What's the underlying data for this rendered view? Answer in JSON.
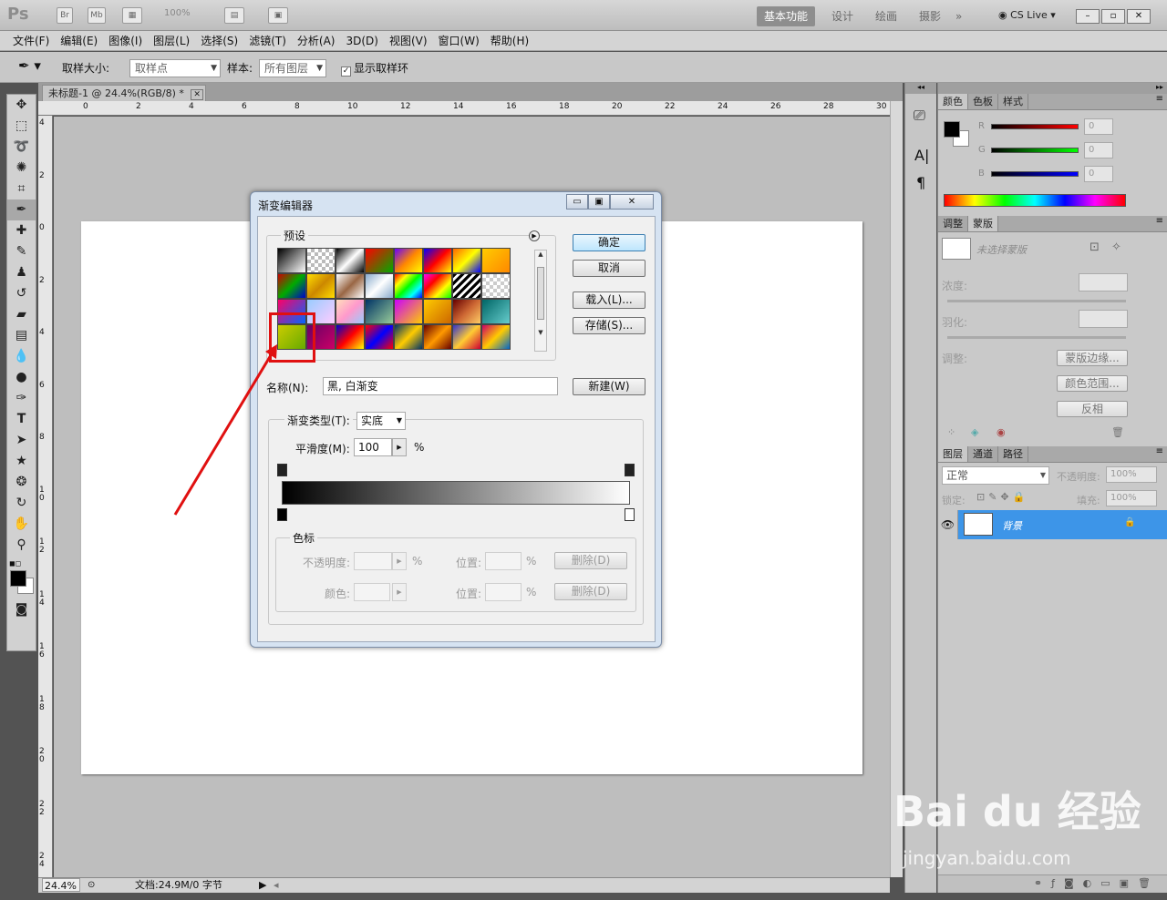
{
  "appbar": {
    "logo": "Ps",
    "icons": [
      "Br",
      "Mb"
    ],
    "zoom": "100%",
    "workspaces": [
      "基本功能",
      "设计",
      "绘画",
      "摄影"
    ],
    "more": "»",
    "cslive": "CS Live",
    "window_buttons": [
      "–",
      "▫",
      "✕"
    ]
  },
  "menu": [
    "文件(F)",
    "编辑(E)",
    "图像(I)",
    "图层(L)",
    "选择(S)",
    "滤镜(T)",
    "分析(A)",
    "3D(D)",
    "视图(V)",
    "窗口(W)",
    "帮助(H)"
  ],
  "options": {
    "sample_size_label": "取样大小:",
    "sample_size_value": "取样点",
    "sample_label": "样本:",
    "sample_value": "所有图层",
    "show_ring_label": "显示取样环",
    "show_ring_checked": "✓"
  },
  "document": {
    "tab_title": "未标题-1 @ 24.4%(RGB/8) *",
    "tab_close": "✕",
    "ruler_h": [
      "0",
      "2",
      "4",
      "6",
      "8",
      "10",
      "12",
      "14",
      "16",
      "18",
      "20",
      "22",
      "24",
      "26",
      "28",
      "30"
    ],
    "ruler_v": [
      "4",
      "2",
      "0",
      "2",
      "4",
      "6",
      "8",
      "10",
      "12",
      "14",
      "16",
      "18",
      "20",
      "22",
      "24"
    ],
    "status_zoom": "24.4%",
    "status_doc": "文档:24.9M/0 字节"
  },
  "color_panel": {
    "tabs": [
      "颜色",
      "色板",
      "样式"
    ],
    "channels": [
      {
        "label": "R",
        "value": "0",
        "color": "#cc0000"
      },
      {
        "label": "G",
        "value": "0",
        "color": "#00b000"
      },
      {
        "label": "B",
        "value": "0",
        "color": "#0000cc"
      }
    ]
  },
  "mask_panel": {
    "tabs": [
      "调整",
      "蒙版"
    ],
    "no_mask": "未选择蒙版",
    "density": "浓度:",
    "feather": "羽化:",
    "adjust": "调整:",
    "buttons": [
      "蒙版边缘...",
      "颜色范围...",
      "反相"
    ]
  },
  "layers_panel": {
    "tabs": [
      "图层",
      "通道",
      "路径"
    ],
    "blend_mode": "正常",
    "opacity_label": "不透明度:",
    "opacity_value": "100%",
    "lock_label": "锁定:",
    "fill_label": "填充:",
    "fill_value": "100%",
    "layer_name": "背景"
  },
  "dialog": {
    "title": "渐变编辑器",
    "presets_label": "预设",
    "ok": "确定",
    "cancel": "取消",
    "load": "载入(L)...",
    "save": "存储(S)...",
    "name_label": "名称(N):",
    "name_value": "黑, 白渐变",
    "new": "新建(W)",
    "type_label": "渐变类型(T):",
    "type_value": "实底",
    "smooth_label": "平滑度(M):",
    "smooth_value": "100",
    "percent": "%",
    "stops_label": "色标",
    "opacity_label": "不透明度:",
    "position_label": "位置:",
    "color_label": "颜色:",
    "delete": "删除(D)"
  },
  "watermark": {
    "brand": "Bai du 经验",
    "url": "jingyan.baidu.com"
  }
}
